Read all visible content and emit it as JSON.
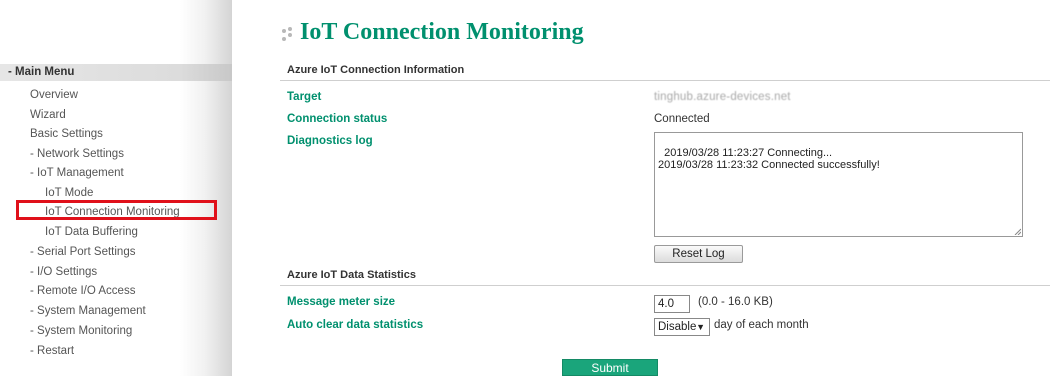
{
  "sidebar": {
    "header": "- Main Menu",
    "items": [
      {
        "label": "Overview"
      },
      {
        "label": "Wizard"
      },
      {
        "label": "Basic Settings"
      },
      {
        "label": "- Network Settings"
      },
      {
        "label": "- IoT Management"
      },
      {
        "label": "IoT Mode"
      },
      {
        "label": "IoT Connection Monitoring",
        "selected": true
      },
      {
        "label": "IoT Data Buffering"
      },
      {
        "label": "- Serial Port Settings"
      },
      {
        "label": "- I/O Settings"
      },
      {
        "label": "- Remote I/O Access"
      },
      {
        "label": "- System Management"
      },
      {
        "label": "- System Monitoring"
      },
      {
        "label": "- Restart"
      }
    ],
    "highlight_color": "#e0101a"
  },
  "page": {
    "title": "IoT Connection Monitoring",
    "title_color": "#00906e"
  },
  "connection_info": {
    "heading": "Azure IoT Connection Information",
    "target_label": "Target",
    "target_value": "tinghub.azure-devices.net",
    "status_label": "Connection status",
    "status_value": "Connected",
    "log_label": "Diagnostics log",
    "log_text": "2019/03/28 11:23:27 Connecting...\n2019/03/28 11:23:32 Connected successfully!",
    "reset_button": "Reset Log"
  },
  "data_statistics": {
    "heading": "Azure IoT Data Statistics",
    "meter_label": "Message meter size",
    "meter_value": "4.0",
    "meter_range": "(0.0 - 16.0 KB)",
    "autoclear_label": "Auto clear data statistics",
    "autoclear_value": "Disable",
    "autoclear_suffix": "day of each month"
  },
  "submit_button": "Submit",
  "accent_color": "#1aa57b"
}
